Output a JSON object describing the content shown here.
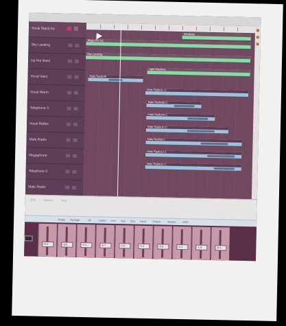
{
  "tracks": [
    {
      "name": "Vocal Stack.mc"
    },
    {
      "name": "Sky Landing"
    },
    {
      "name": "Up Hot Bass"
    },
    {
      "name": "Vocal Vaint"
    },
    {
      "name": "Vocal Warm"
    },
    {
      "name": "Telephone V."
    },
    {
      "name": "Vocal Reflex"
    },
    {
      "name": "Male Radio"
    },
    {
      "name": "Megaphone"
    },
    {
      "name": "Telephone V."
    },
    {
      "name": "Male Radio"
    }
  ],
  "regions": [
    {
      "label": "Windows",
      "color": "green"
    },
    {
      "label": "Mega PR 5G",
      "color": "green"
    },
    {
      "label": "Sky Landing",
      "color": "green"
    },
    {
      "label": "Light Machine",
      "color": "green"
    },
    {
      "label": "Male Radio44",
      "color": "blue"
    },
    {
      "label": "Male Radio11 C",
      "color": "blue"
    },
    {
      "label": "Male Radio98 C",
      "color": "blue"
    },
    {
      "label": "Male Radio44 C",
      "color": "blue"
    },
    {
      "label": "Male Radio10 C",
      "color": "blue"
    },
    {
      "label": "Male Radio9 C",
      "color": "blue"
    },
    {
      "label": "Male Radio13 C",
      "color": "blue"
    },
    {
      "label": "Male Radio12 C",
      "color": "blue"
    }
  ],
  "tabs": [
    "Single",
    "Arrange",
    "All",
    "Audio",
    "Inst",
    "Aux",
    "Bus",
    "Input",
    "Output",
    "Master",
    "MIDI"
  ],
  "mixer_values": [
    "-8.3",
    "-8.8",
    "-4.3",
    "-9.7",
    "-0.8",
    "-4.2",
    "-6.8",
    "-3.1",
    "-2.9",
    "-8.4"
  ],
  "lower_labels": [
    "Edit",
    "Options",
    "View"
  ]
}
